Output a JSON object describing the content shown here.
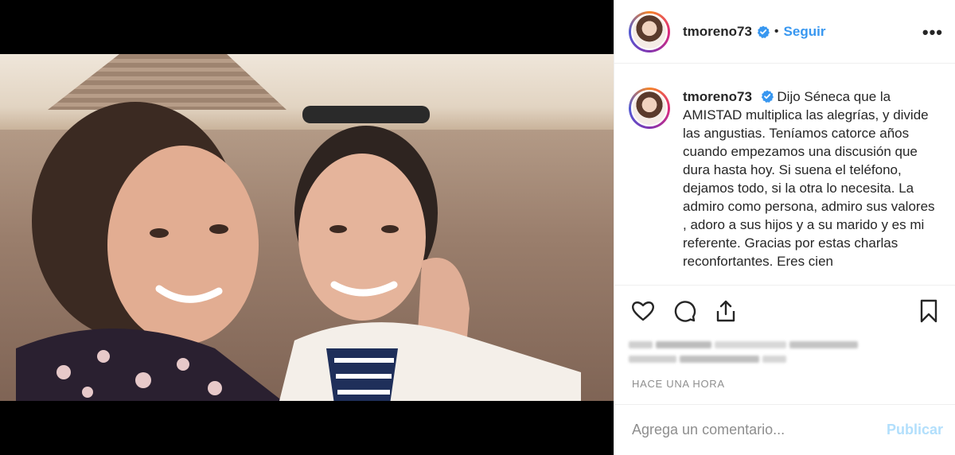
{
  "post": {
    "username": "tmoreno73",
    "follow_label": "Seguir",
    "separator": "•",
    "more_label": "•••",
    "caption_username": "tmoreno73",
    "caption_text": "Dijo Séneca que la AMISTAD multiplica las alegrías, y divide las angustias. Teníamos catorce años cuando empezamos una discusión que dura hasta hoy. Si suena el teléfono, dejamos todo, si la otra lo necesita. La admiro como persona, admiro sus valores , adoro a sus hijos y a su marido y es mi referente. Gracias por estas charlas reconfortantes. Eres cien",
    "timestamp": "HACE UNA HORA"
  },
  "actions": {
    "like_icon": "heart-icon",
    "comment_icon": "comment-icon",
    "share_icon": "share-icon",
    "save_icon": "bookmark-icon"
  },
  "comment": {
    "placeholder": "Agrega un comentario...",
    "publish_label": "Publicar"
  },
  "colors": {
    "link": "#3897f0",
    "verified": "#3897f0",
    "publish_disabled": "#b2dffc",
    "muted": "#8e8e8e"
  }
}
